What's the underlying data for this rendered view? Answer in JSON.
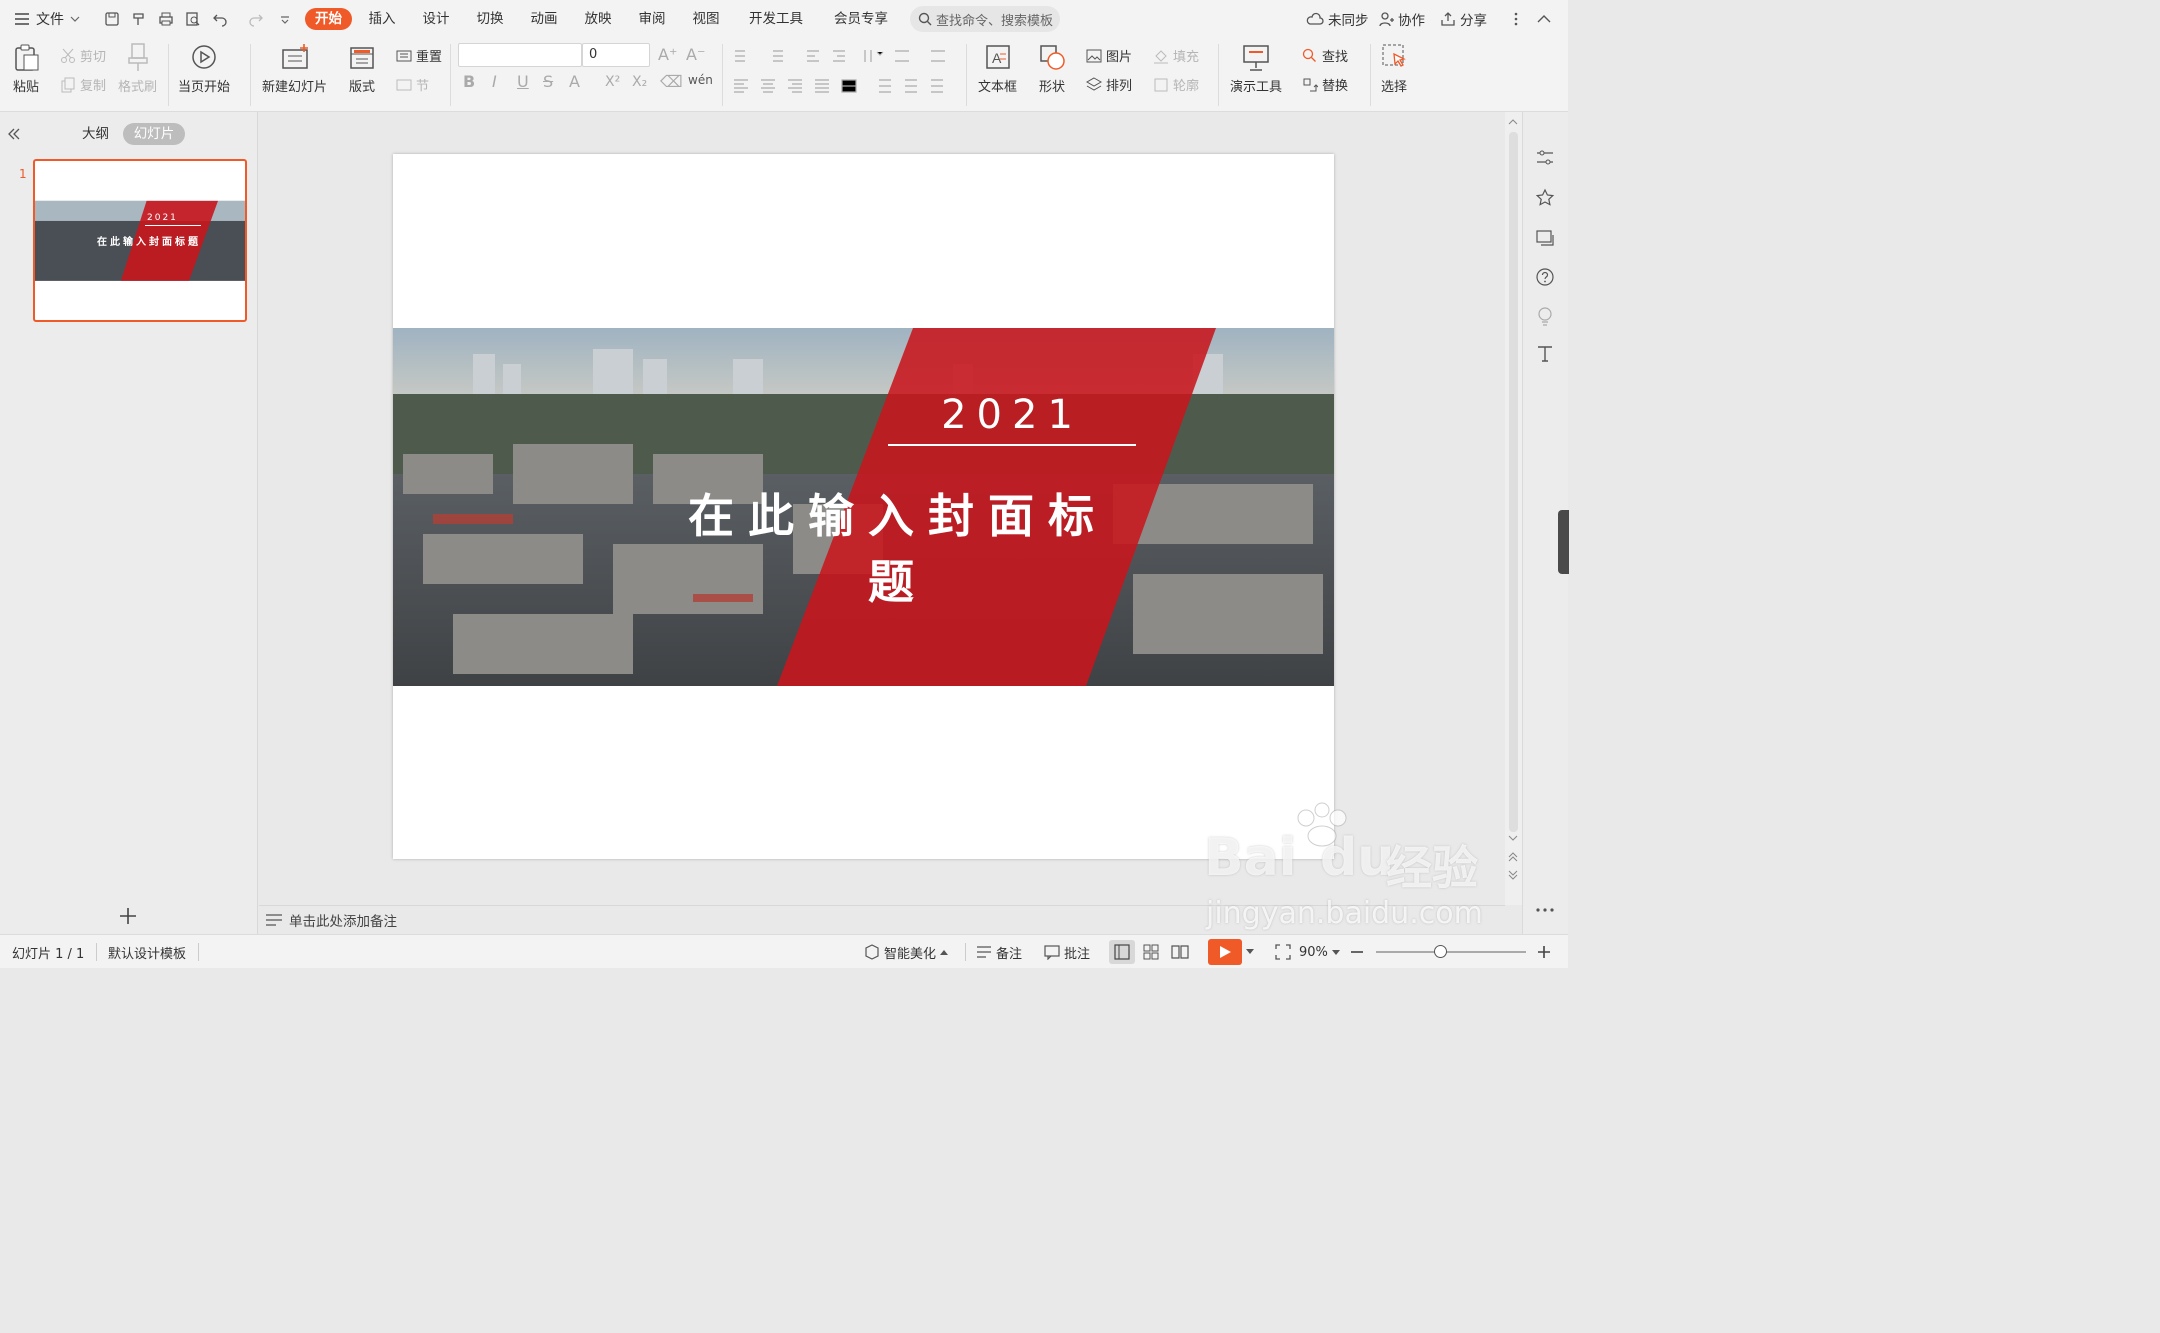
{
  "titlebar": {
    "file_label": "文件",
    "tabs": [
      "开始",
      "插入",
      "设计",
      "切换",
      "动画",
      "放映",
      "审阅",
      "视图",
      "开发工具",
      "会员专享"
    ],
    "search_placeholder": "查找命令、搜索模板",
    "sync_label": "未同步",
    "collab_label": "协作",
    "share_label": "分享"
  },
  "ribbon": {
    "paste": "粘贴",
    "cut": "剪切",
    "copy": "复制",
    "format_painter": "格式刷",
    "from_current": "当页开始",
    "new_slide": "新建幻灯片",
    "layout": "版式",
    "reset": "重置",
    "section": "节",
    "font_size_value": "0",
    "textbox": "文本框",
    "shape": "形状",
    "picture": "图片",
    "arrange": "排列",
    "fill": "填充",
    "outline": "轮廓",
    "present_tools": "演示工具",
    "find": "查找",
    "replace": "替换",
    "select": "选择"
  },
  "left_panel": {
    "outline_tab": "大纲",
    "slides_tab": "幻灯片",
    "slide_number": "1",
    "thumb_year": "2021",
    "thumb_title": "在此输入封面标题"
  },
  "slide": {
    "year": "2021",
    "title": "在此输入封面标题",
    "accent_color": "#c8161d"
  },
  "notes_placeholder": "单击此处添加备注",
  "statusbar": {
    "slide_info": "幻灯片 1 / 1",
    "template": "默认设计模板",
    "beautify": "智能美化",
    "notes": "备注",
    "comments": "批注",
    "zoom": "90%"
  },
  "watermark": {
    "brand": "Bai",
    "brand2": "du",
    "cn": "经验",
    "url": "jingyan.baidu.com"
  },
  "colors": {
    "accent": "#f05a28",
    "slide_red": "#c8161d"
  }
}
